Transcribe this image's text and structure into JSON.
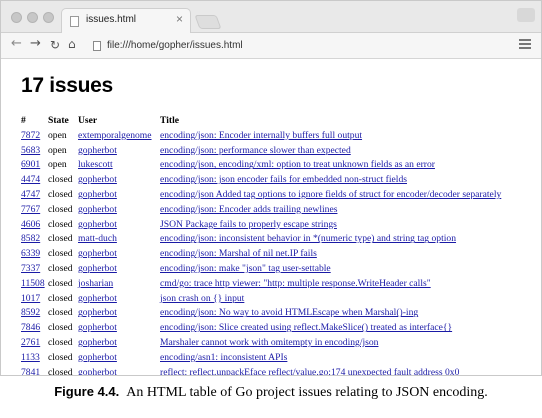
{
  "browser": {
    "tab_title": "issues.html",
    "tab_close": "×",
    "url": "file:///home/gopher/issues.html"
  },
  "page": {
    "heading": "17 issues",
    "columns": [
      "#",
      "State",
      "User",
      "Title"
    ],
    "rows": [
      {
        "id": "7872",
        "state": "open",
        "user": "extemporalgenome",
        "title": "encoding/json: Encoder internally buffers full output"
      },
      {
        "id": "5683",
        "state": "open",
        "user": "gopherbot",
        "title": "encoding/json: performance slower than expected"
      },
      {
        "id": "6901",
        "state": "open",
        "user": "lukescott",
        "title": "encoding/json, encoding/xml: option to treat unknown fields as an error"
      },
      {
        "id": "4474",
        "state": "closed",
        "user": "gopherbot",
        "title": "encoding/json: json encoder fails for embedded non-struct fields"
      },
      {
        "id": "4747",
        "state": "closed",
        "user": "gopherbot",
        "title": "encoding/json Added tag options to ignore fields of struct for encoder/decoder separately"
      },
      {
        "id": "7767",
        "state": "closed",
        "user": "gopherbot",
        "title": "encoding/json: Encoder adds trailing newlines"
      },
      {
        "id": "4606",
        "state": "closed",
        "user": "gopherbot",
        "title": "JSON Package fails to properly escape strings"
      },
      {
        "id": "8582",
        "state": "closed",
        "user": "matt-duch",
        "title": "encoding/json: inconsistent behavior in *(numeric type) and string tag option"
      },
      {
        "id": "6339",
        "state": "closed",
        "user": "gopherbot",
        "title": "encoding/json: Marshal of nil net.IP fails"
      },
      {
        "id": "7337",
        "state": "closed",
        "user": "gopherbot",
        "title": "encoding/json: make \"json\" tag user-settable"
      },
      {
        "id": "11508",
        "state": "closed",
        "user": "josharian",
        "title": "cmd/go: trace http viewer: \"http: multiple response.WriteHeader calls\""
      },
      {
        "id": "1017",
        "state": "closed",
        "user": "gopherbot",
        "title": "json crash on {} input"
      },
      {
        "id": "8592",
        "state": "closed",
        "user": "gopherbot",
        "title": "encoding/json: No way to avoid HTMLEscape when Marshal()-ing"
      },
      {
        "id": "7846",
        "state": "closed",
        "user": "gopherbot",
        "title": "encoding/json: Slice created using reflect.MakeSlice() treated as interface{}"
      },
      {
        "id": "2761",
        "state": "closed",
        "user": "gopherbot",
        "title": "Marshaler cannot work with omitempty in encoding/json"
      },
      {
        "id": "1133",
        "state": "closed",
        "user": "gopherbot",
        "title": "encoding/asn1: inconsistent APIs"
      },
      {
        "id": "7841",
        "state": "closed",
        "user": "gopherbot",
        "title": "reflect: reflect.unpackEface reflect/value.go:174 unexpected fault address 0x0"
      }
    ]
  },
  "caption": {
    "label": "Figure 4.4.",
    "text": "An HTML table of Go project issues relating to JSON encoding."
  },
  "colors": {
    "link": "#1a1aa6",
    "chrome": "#e9e9e9"
  }
}
